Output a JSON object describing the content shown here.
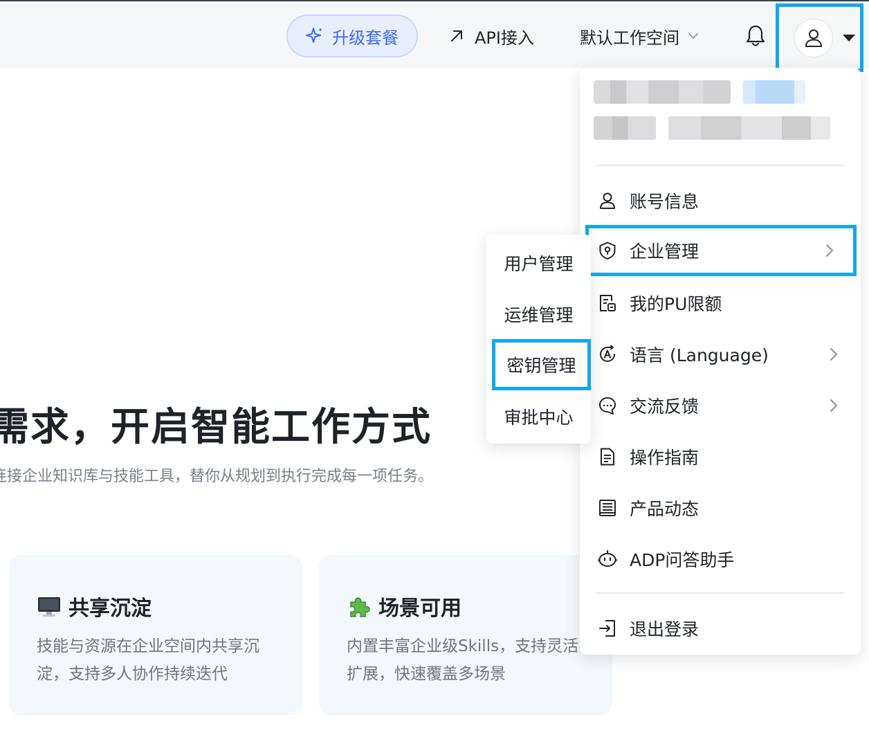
{
  "header": {
    "upgrade_label": "升级套餐",
    "api_label": "API接入",
    "workspace_label": "默认工作空间",
    "accent_color": "#3b6cf6",
    "highlight_color": "#14a7f0"
  },
  "hero": {
    "title": "需求，开启智能工作方式",
    "subtitle": "连接企业知识库与技能工具，替你从规划到执行完成每一项任务。"
  },
  "cards": [
    {
      "icon": "computer-icon",
      "title": "共享沉淀",
      "desc": "技能与资源在企业空间内共享沉淀，支持多人协作持续迭代"
    },
    {
      "icon": "puzzle-icon",
      "title": "场景可用",
      "desc": "内置丰富企业级Skills，支持灵活扩展，快速覆盖多场景"
    }
  ],
  "user_menu": {
    "items": [
      {
        "label": "账号信息",
        "icon": "user-icon",
        "has_submenu": false
      },
      {
        "label": "企业管理",
        "icon": "shield-icon",
        "has_submenu": true
      },
      {
        "label": "我的PU限额",
        "icon": "quota-icon",
        "has_submenu": false
      },
      {
        "label": "语言 (Language)",
        "icon": "language-icon",
        "has_submenu": true
      },
      {
        "label": "交流反馈",
        "icon": "feedback-icon",
        "has_submenu": true
      },
      {
        "label": "操作指南",
        "icon": "document-icon",
        "has_submenu": false
      },
      {
        "label": "产品动态",
        "icon": "news-icon",
        "has_submenu": false
      },
      {
        "label": "ADP问答助手",
        "icon": "robot-icon",
        "has_submenu": false
      }
    ],
    "logout_label": "退出登录"
  },
  "enterprise_submenu": {
    "items": [
      "用户管理",
      "运维管理",
      "密钥管理",
      "审批中心"
    ]
  }
}
